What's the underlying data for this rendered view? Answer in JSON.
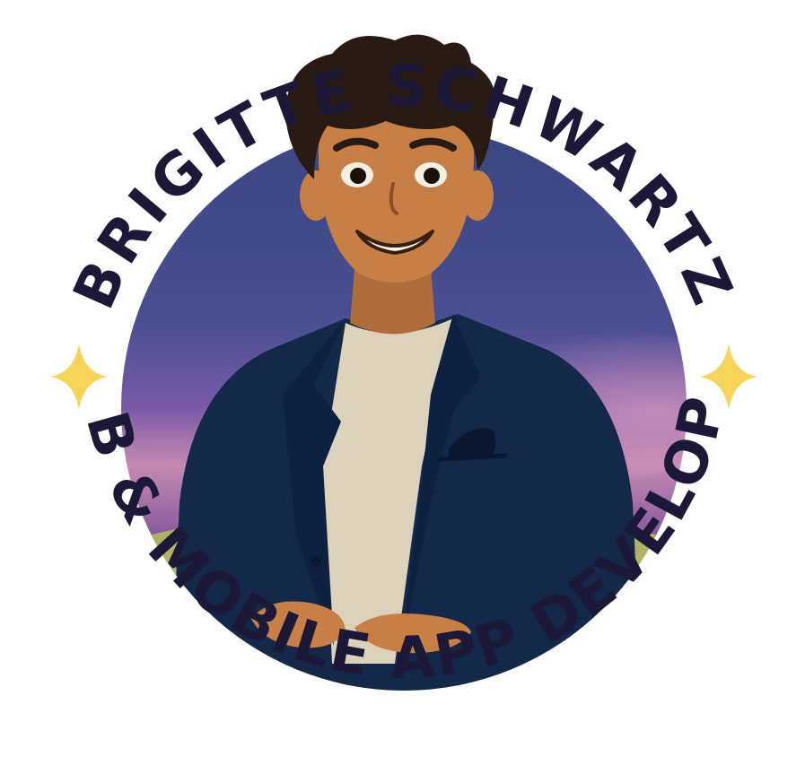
{
  "badge": {
    "name": "BRIGITTE SCHWARTZ",
    "role": "WEB & MOBILE APP DEVELOPER"
  },
  "colors": {
    "text": "#1b1838",
    "sparkle": "#f6d45a",
    "sky_top": "#3a4580",
    "sky_glow": "#8a5aa8",
    "horizon": "#c48ab0",
    "ground": "#b5c060",
    "jacket": "#14294a",
    "shirt": "#dcd2bc",
    "skin": "#c77f45",
    "hair": "#2a1a14"
  },
  "icons": {
    "left_ornament": "four-point-sparkle",
    "right_ornament": "four-point-sparkle"
  }
}
